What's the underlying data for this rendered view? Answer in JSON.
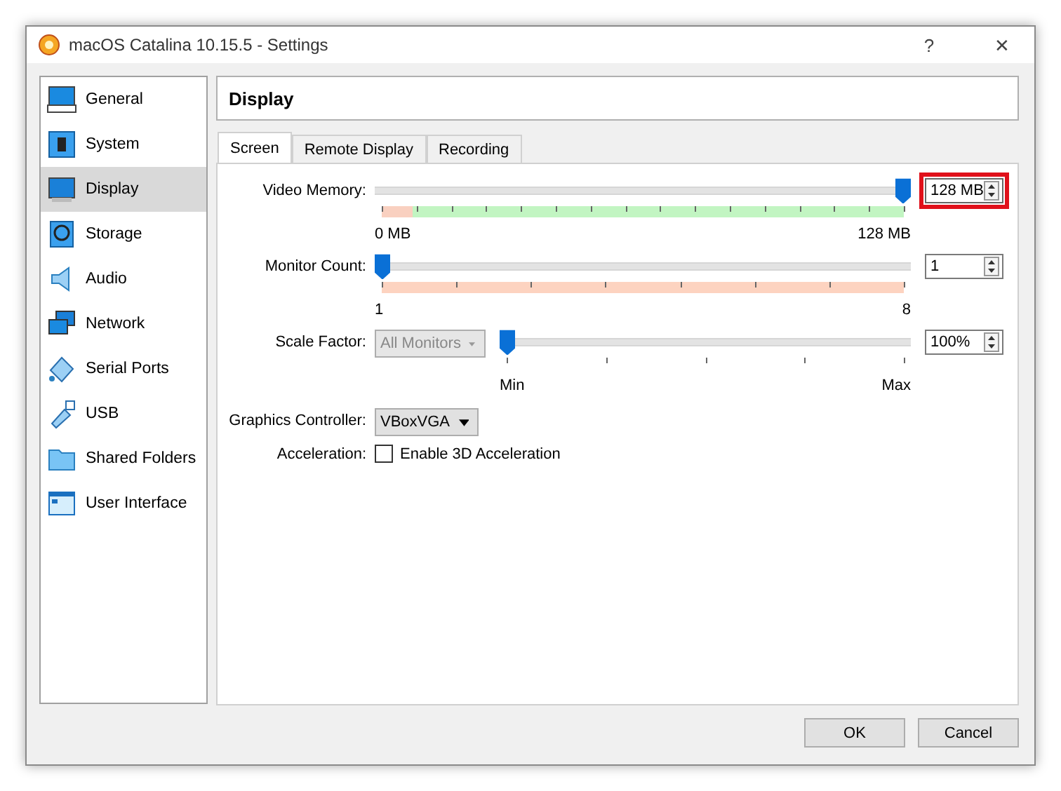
{
  "window": {
    "title": "macOS Catalina 10.15.5 - Settings",
    "help": "?",
    "close": "✕"
  },
  "sidebar": {
    "items": [
      {
        "label": "General",
        "selected": false
      },
      {
        "label": "System",
        "selected": false
      },
      {
        "label": "Display",
        "selected": true
      },
      {
        "label": "Storage",
        "selected": false
      },
      {
        "label": "Audio",
        "selected": false
      },
      {
        "label": "Network",
        "selected": false
      },
      {
        "label": "Serial Ports",
        "selected": false
      },
      {
        "label": "USB",
        "selected": false
      },
      {
        "label": "Shared Folders",
        "selected": false
      },
      {
        "label": "User Interface",
        "selected": false
      }
    ]
  },
  "page_title": "Display",
  "tabs": [
    {
      "label": "Screen",
      "selected": true
    },
    {
      "label": "Remote Display",
      "selected": false
    },
    {
      "label": "Recording",
      "selected": false
    }
  ],
  "video_memory": {
    "label": "Video Memory:",
    "level": 1,
    "value": "128 MB",
    "highlighted": true,
    "min_label": "0 MB",
    "max_label": "128 MB"
  },
  "monitor_count": {
    "label": "Monitor Count:",
    "level": 0,
    "value": "1",
    "min_label": "1",
    "max_label": "8"
  },
  "scale_factor": {
    "label": "Scale Factor:",
    "scope": "All Monitors",
    "scope_disabled": true,
    "level": 0,
    "value": "100%",
    "min_label": "Min",
    "max_label": "Max"
  },
  "graphics_controller": {
    "label": "Graphics Controller:",
    "value": "VBoxVGA"
  },
  "acceleration": {
    "label": "Acceleration:",
    "option": "Enable 3D Acceleration",
    "checked": false
  },
  "buttons": [
    "OK",
    "Cancel"
  ]
}
